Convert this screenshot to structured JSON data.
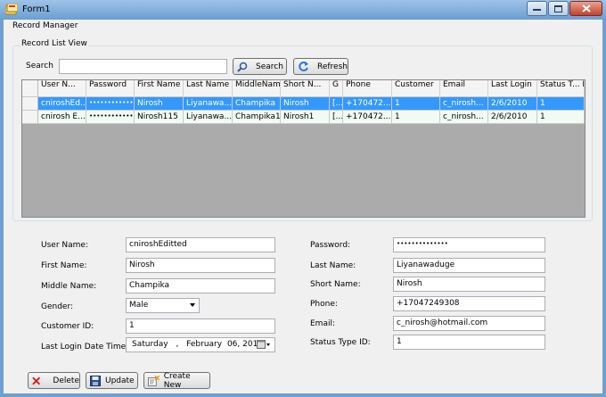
{
  "window": {
    "title": "Form1"
  },
  "menu": {
    "label": "Record Manager"
  },
  "list_group": {
    "title": "Record List View",
    "search_label": "Search",
    "search_value": "",
    "search_button": "Search",
    "refresh_button": "Refresh"
  },
  "grid": {
    "columns": [
      "User N...",
      "Password",
      "First Name",
      "Last Name",
      "MiddleName",
      "Short N...",
      "G",
      "Phone",
      "Customer",
      "Email",
      "Last Login",
      "Status T... ID"
    ],
    "rows": [
      [
        "cniroshEd...",
        "••••••••••••••",
        "Nirosh",
        "Liyanawa...",
        "Champika",
        "Nirosh",
        "[...",
        "+170472...",
        "1",
        "c_nirosh...",
        "2/6/2010",
        "1"
      ],
      [
        "cnirosh E...",
        "••••••••••••••",
        "Nirosh115",
        "Liyanawa...",
        "Champika1",
        "Nirosh1",
        "[...",
        "+170472...",
        "1",
        "c_nirosh...",
        "2/6/2010",
        "1"
      ]
    ]
  },
  "form": {
    "username_label": "User Name:",
    "username": "cniroshEditted",
    "firstname_label": "First Name:",
    "firstname": "Nirosh",
    "middlename_label": "Middle Name:",
    "middlename": "Champika",
    "gender_label": "Gender:",
    "gender": "Male",
    "customerid_label": "Customer ID:",
    "customerid": "1",
    "lastlogin_label": "Last Login Date Time:",
    "lastlogin_day": "Saturday",
    "lastlogin_sep": ",",
    "lastlogin_month": "February",
    "lastlogin_date": "06, 2010",
    "password_label": "Password:",
    "password": "••••••••••••••",
    "lastname_label": "Last Name:",
    "lastname": "Liyanawaduge",
    "shortname_label": "Short Name:",
    "shortname": "Nirosh",
    "phone_label": "Phone:",
    "phone": "+17047249308",
    "email_label": "Email:",
    "email": "c_nirosh@hotmail.com",
    "statustype_label": "Status Type ID:",
    "statustype": "1"
  },
  "actions": {
    "delete": "Delete",
    "update": "Update",
    "create": "Create New"
  }
}
